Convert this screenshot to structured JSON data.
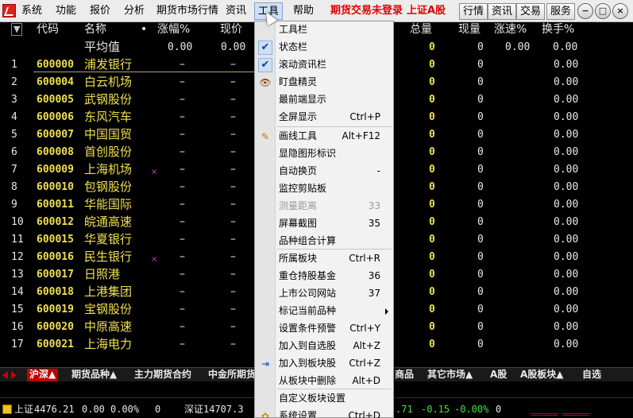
{
  "menubar": {
    "items": [
      "系统",
      "功能",
      "报价",
      "分析",
      "期货市场行情",
      "资讯",
      "工具",
      "帮助"
    ],
    "warnings": [
      "期货交易未登录",
      "上证A股"
    ],
    "toolbar_buttons": [
      "行情",
      "资讯",
      "交易",
      "服务"
    ],
    "window_buttons": [
      "−",
      "□",
      "×"
    ]
  },
  "table": {
    "sort_icon": "▼",
    "headers": [
      "代码",
      "名称",
      "•",
      "涨幅%",
      "现价",
      "总量",
      "现量",
      "涨速%",
      "换手%"
    ],
    "avg_row": {
      "label": "平均值",
      "change": "0.00",
      "price": "0.00",
      "volume": "0",
      "cur_volume": "0",
      "speed": "0.00",
      "turnover": "0.00"
    },
    "rows": [
      {
        "idx": "1",
        "code": "600000",
        "name": "浦发银行",
        "mark": "",
        "change": "–",
        "price": "–",
        "volume": "0",
        "cur_volume": "0",
        "speed": "0.00",
        "turnover": "0.00"
      },
      {
        "idx": "2",
        "code": "600004",
        "name": "白云机场",
        "mark": "",
        "change": "–",
        "price": "–",
        "volume": "0",
        "cur_volume": "0",
        "speed": "0.00",
        "turnover": "0.00"
      },
      {
        "idx": "3",
        "code": "600005",
        "name": "武钢股份",
        "mark": "",
        "change": "–",
        "price": "–",
        "volume": "0",
        "cur_volume": "0",
        "speed": "0.00",
        "turnover": "0.00"
      },
      {
        "idx": "4",
        "code": "600006",
        "name": "东风汽车",
        "mark": "",
        "change": "–",
        "price": "–",
        "volume": "0",
        "cur_volume": "0",
        "speed": "0.00",
        "turnover": "0.00"
      },
      {
        "idx": "5",
        "code": "600007",
        "name": "中国国贸",
        "mark": "",
        "change": "–",
        "price": "–",
        "volume": "0",
        "cur_volume": "0",
        "speed": "0.00",
        "turnover": "0.00"
      },
      {
        "idx": "6",
        "code": "600008",
        "name": "首创股份",
        "mark": "",
        "change": "–",
        "price": "–",
        "volume": "0",
        "cur_volume": "0",
        "speed": "0.00",
        "turnover": "0.00"
      },
      {
        "idx": "7",
        "code": "600009",
        "name": "上海机场",
        "mark": "×",
        "change": "–",
        "price": "–",
        "volume": "0",
        "cur_volume": "0",
        "speed": "0.00",
        "turnover": "0.00"
      },
      {
        "idx": "8",
        "code": "600010",
        "name": "包钢股份",
        "mark": "",
        "change": "–",
        "price": "–",
        "volume": "0",
        "cur_volume": "0",
        "speed": "0.00",
        "turnover": "0.00"
      },
      {
        "idx": "9",
        "code": "600011",
        "name": "华能国际",
        "mark": "",
        "change": "–",
        "price": "–",
        "volume": "0",
        "cur_volume": "0",
        "speed": "0.00",
        "turnover": "0.00"
      },
      {
        "idx": "10",
        "code": "600012",
        "name": "皖通高速",
        "mark": "",
        "change": "–",
        "price": "–",
        "volume": "0",
        "cur_volume": "0",
        "speed": "0.00",
        "turnover": "0.00"
      },
      {
        "idx": "11",
        "code": "600015",
        "name": "华夏银行",
        "mark": "",
        "change": "–",
        "price": "–",
        "volume": "0",
        "cur_volume": "0",
        "speed": "0.00",
        "turnover": "0.00"
      },
      {
        "idx": "12",
        "code": "600016",
        "name": "民生银行",
        "mark": "×",
        "change": "–",
        "price": "–",
        "volume": "0",
        "cur_volume": "0",
        "speed": "0.00",
        "turnover": "0.00"
      },
      {
        "idx": "13",
        "code": "600017",
        "name": "日照港",
        "mark": "",
        "change": "–",
        "price": "–",
        "volume": "0",
        "cur_volume": "0",
        "speed": "0.00",
        "turnover": "0.00"
      },
      {
        "idx": "14",
        "code": "600018",
        "name": "上港集团",
        "mark": "",
        "change": "–",
        "price": "–",
        "volume": "0",
        "cur_volume": "0",
        "speed": "0.00",
        "turnover": "0.00"
      },
      {
        "idx": "15",
        "code": "600019",
        "name": "宝钢股份",
        "mark": "",
        "change": "–",
        "price": "–",
        "volume": "0",
        "cur_volume": "0",
        "speed": "0.00",
        "turnover": "0.00"
      },
      {
        "idx": "16",
        "code": "600020",
        "name": "中原高速",
        "mark": "",
        "change": "–",
        "price": "–",
        "volume": "0",
        "cur_volume": "0",
        "speed": "0.00",
        "turnover": "0.00"
      },
      {
        "idx": "17",
        "code": "600021",
        "name": "上海电力",
        "mark": "",
        "change": "–",
        "price": "–",
        "volume": "0",
        "cur_volume": "0",
        "speed": "0.00",
        "turnover": "0.00"
      }
    ]
  },
  "tabs": [
    "沪深▲",
    "期货品种▲",
    "主力期货合约",
    "中金所期货",
    "商品",
    "其它市场▲",
    "A股",
    "A股板块▲",
    "自选"
  ],
  "status": {
    "sh_label": "上证",
    "sh_value": "4476.21",
    "sh_change": "0.00",
    "sh_pct": "0.00%",
    "sh_vol": "0",
    "sz_label": "深证",
    "sz_value": "14707.3",
    "r_val1": ".71",
    "r_val2": "-0.15",
    "r_val3": "-0.00%",
    "r_val4": "0",
    "marks": "====== ======"
  },
  "dropdown": {
    "items": [
      {
        "label": "工具栏",
        "shortcut": "",
        "check": false,
        "icon": "",
        "disabled": false
      },
      {
        "label": "状态栏",
        "shortcut": "",
        "check": true,
        "icon": "",
        "disabled": false
      },
      {
        "label": "滚动资讯栏",
        "shortcut": "",
        "check": true,
        "icon": "",
        "disabled": false
      },
      {
        "label": "盯盘精灵",
        "shortcut": "",
        "check": false,
        "icon": "eye",
        "disabled": false
      },
      {
        "label": "最前端显示",
        "shortcut": "",
        "check": false,
        "icon": "",
        "disabled": false
      },
      {
        "label": "全屏显示",
        "shortcut": "Ctrl+P",
        "check": false,
        "icon": "",
        "disabled": false
      },
      {
        "label": "画线工具",
        "shortcut": "Alt+F12",
        "check": false,
        "icon": "pencil",
        "disabled": false
      },
      {
        "label": "显隐图形标识",
        "shortcut": "",
        "check": false,
        "icon": "",
        "disabled": false
      },
      {
        "label": "自动换页",
        "shortcut": "-",
        "check": false,
        "icon": "",
        "disabled": false
      },
      {
        "label": "监控剪贴板",
        "shortcut": "",
        "check": false,
        "icon": "",
        "disabled": false
      },
      {
        "label": "测量距离",
        "shortcut": "33",
        "check": false,
        "icon": "",
        "disabled": true
      },
      {
        "label": "屏幕截图",
        "shortcut": "35",
        "check": false,
        "icon": "",
        "disabled": false
      },
      {
        "label": "品种组合计算",
        "shortcut": "",
        "check": false,
        "icon": "",
        "disabled": false
      },
      {
        "label": "所属板块",
        "shortcut": "Ctrl+R",
        "check": false,
        "icon": "",
        "disabled": false
      },
      {
        "label": "重仓持股基金",
        "shortcut": "36",
        "check": false,
        "icon": "",
        "disabled": false
      },
      {
        "label": "上市公司网站",
        "shortcut": "37",
        "check": false,
        "icon": "",
        "disabled": false
      },
      {
        "label": "标记当前品种",
        "shortcut": "",
        "check": false,
        "icon": "",
        "disabled": false,
        "submenu": true
      },
      {
        "label": "设置条件预警",
        "shortcut": "Ctrl+Y",
        "check": false,
        "icon": "",
        "disabled": false
      },
      {
        "label": "加入到自选股",
        "shortcut": "Alt+Z",
        "check": false,
        "icon": "",
        "disabled": false
      },
      {
        "label": "加入到板块股",
        "shortcut": "Ctrl+Z",
        "check": false,
        "icon": "add-to-block",
        "disabled": false
      },
      {
        "label": "从板块中删除",
        "shortcut": "Alt+D",
        "check": false,
        "icon": "",
        "disabled": false
      },
      {
        "label": "自定义板块设置",
        "shortcut": "",
        "check": false,
        "icon": "",
        "disabled": false
      },
      {
        "label": "系统设置",
        "shortcut": "Ctrl+D",
        "check": false,
        "icon": "gear",
        "disabled": false
      }
    ]
  }
}
